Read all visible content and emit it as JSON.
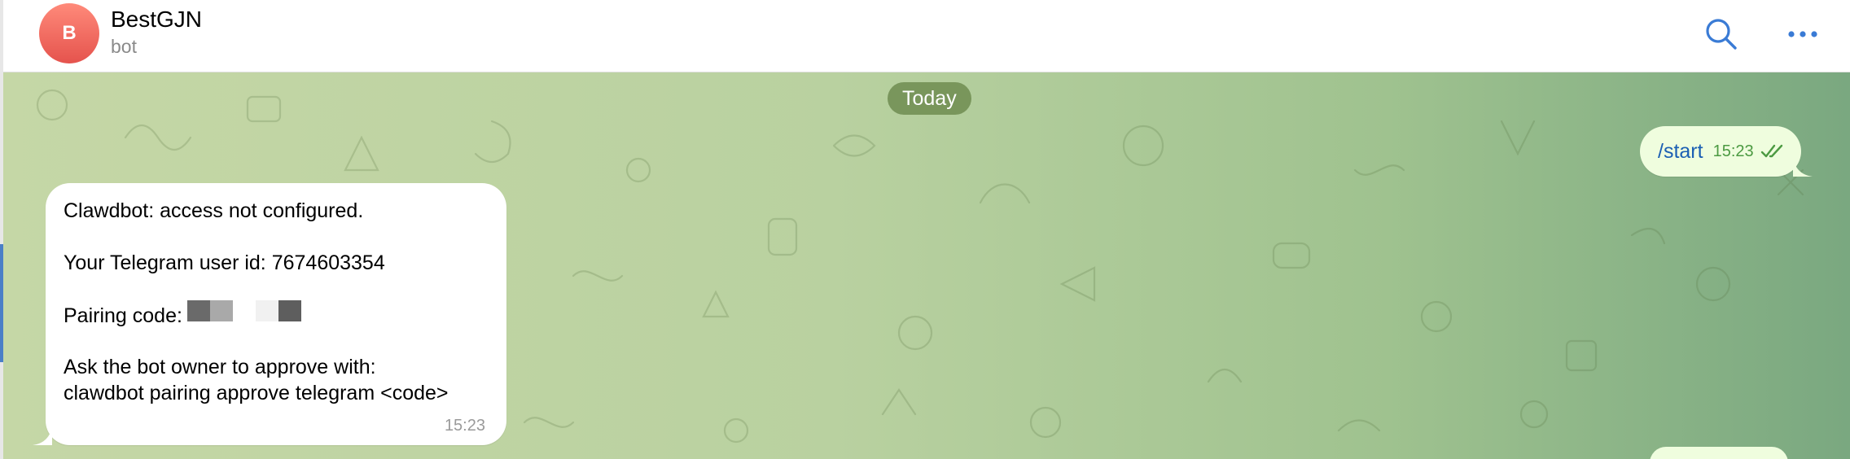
{
  "header": {
    "avatar_letter": "B",
    "title": "BestGJN",
    "subtitle": "bot",
    "avatar_color": "#e5534d",
    "icons": [
      "search-icon",
      "more-icon"
    ]
  },
  "chat": {
    "date_label": "Today",
    "outgoing": {
      "text": "/start",
      "time": "15:23",
      "status_icon": "double-check-icon"
    },
    "incoming": {
      "line1": "Clawdbot: access not configured.",
      "line2": "Your Telegram user id: 7674603354",
      "line3": "Pairing code:",
      "line4": "Ask the bot owner to approve with:",
      "line5": "clawdbot pairing approve telegram <code>",
      "time": "15:23"
    }
  },
  "colors": {
    "accent": "#4a7fc7",
    "outgoing_bubble": "#effdde",
    "incoming_bubble": "#ffffff",
    "link_text": "#1b5fb3",
    "time_green": "#4c9a42"
  }
}
